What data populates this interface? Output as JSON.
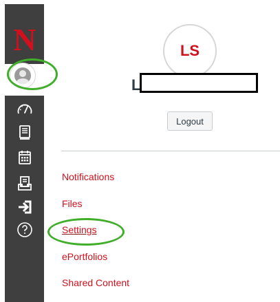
{
  "brand": {
    "logo_letter": "N",
    "logo_color": "#d0101c"
  },
  "profile": {
    "initials": "LS",
    "name_visible_initial": "L",
    "logout_label": "Logout"
  },
  "menu": {
    "items": [
      {
        "label": "Notifications"
      },
      {
        "label": "Files"
      },
      {
        "label": "Settings"
      },
      {
        "label": "ePortfolios"
      },
      {
        "label": "Shared Content"
      }
    ]
  },
  "colors": {
    "nav_bg": "#3f3f3f",
    "link": "#d0101c",
    "highlight_ring": "#3fae29"
  },
  "icons": [
    "account-icon",
    "dashboard-icon",
    "courses-icon",
    "calendar-icon",
    "inbox-icon",
    "commons-icon",
    "help-icon"
  ]
}
